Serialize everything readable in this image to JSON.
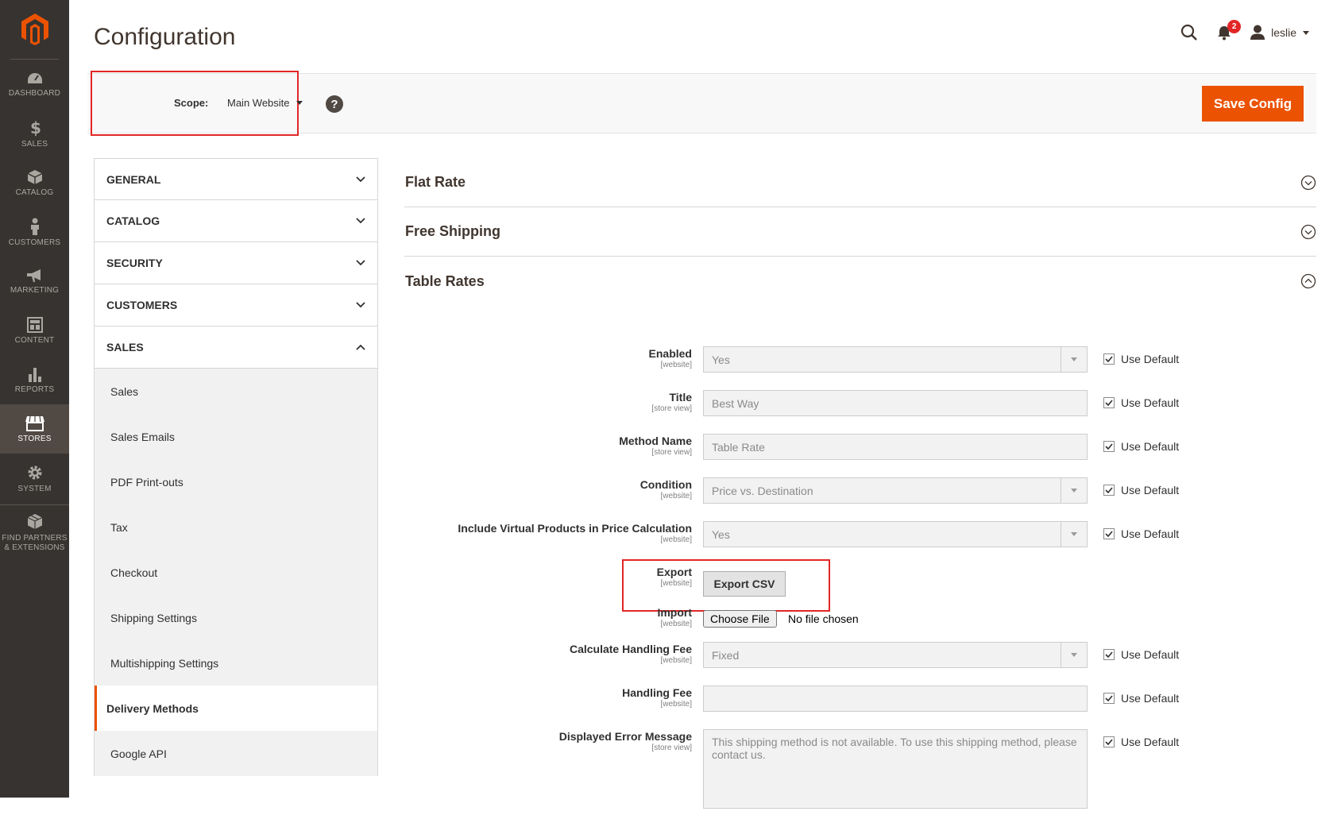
{
  "nav": {
    "items": [
      {
        "label": "DASHBOARD",
        "icon": "dashboard-icon"
      },
      {
        "label": "SALES",
        "icon": "dollar-icon"
      },
      {
        "label": "CATALOG",
        "icon": "cube-icon"
      },
      {
        "label": "CUSTOMERS",
        "icon": "person-icon"
      },
      {
        "label": "MARKETING",
        "icon": "megaphone-icon"
      },
      {
        "label": "CONTENT",
        "icon": "layout-icon"
      },
      {
        "label": "REPORTS",
        "icon": "bar-chart-icon"
      },
      {
        "label": "STORES",
        "icon": "storefront-icon"
      },
      {
        "label": "SYSTEM",
        "icon": "gear-icon"
      }
    ],
    "partners_line1": "FIND PARTNERS",
    "partners_line2": "& EXTENSIONS"
  },
  "header": {
    "title": "Configuration",
    "notification_count": "2",
    "user_name": "leslie"
  },
  "scope": {
    "label": "Scope:",
    "value": "Main Website",
    "help": "?"
  },
  "actions": {
    "save_label": "Save Config"
  },
  "tabs": {
    "groups": [
      "GENERAL",
      "CATALOG",
      "SECURITY",
      "CUSTOMERS",
      "SALES"
    ],
    "sales_items": [
      "Sales",
      "Sales Emails",
      "PDF Print-outs",
      "Tax",
      "Checkout",
      "Shipping Settings",
      "Multishipping Settings",
      "Delivery Methods",
      "Google API"
    ]
  },
  "sections": {
    "flat_rate": "Flat Rate",
    "free_shipping": "Free Shipping",
    "table_rates": "Table Rates"
  },
  "fields": {
    "use_default": "Use Default",
    "enabled": {
      "name": "Enabled",
      "scope": "[website]",
      "value": "Yes"
    },
    "title": {
      "name": "Title",
      "scope": "[store view]",
      "value": "Best Way"
    },
    "method_name": {
      "name": "Method Name",
      "scope": "[store view]",
      "value": "Table Rate"
    },
    "condition": {
      "name": "Condition",
      "scope": "[website]",
      "value": "Price vs. Destination"
    },
    "include_virtual": {
      "name": "Include Virtual Products in Price Calculation",
      "scope": "[website]",
      "value": "Yes"
    },
    "export": {
      "name": "Export",
      "scope": "[website]",
      "button": "Export CSV"
    },
    "import": {
      "name": "Import",
      "scope": "[website]",
      "button": "Choose File",
      "status": "No file chosen"
    },
    "handling_type": {
      "name": "Calculate Handling Fee",
      "scope": "[website]",
      "value": "Fixed"
    },
    "handling_fee": {
      "name": "Handling Fee",
      "scope": "[website]",
      "value": ""
    },
    "error_message": {
      "name": "Displayed Error Message",
      "scope": "[store view]",
      "value": "This shipping method is not available. To use this shipping method, please contact us."
    }
  },
  "colors": {
    "accent": "#eb5202",
    "nav_bg": "#373330",
    "highlight": "#e22626"
  }
}
